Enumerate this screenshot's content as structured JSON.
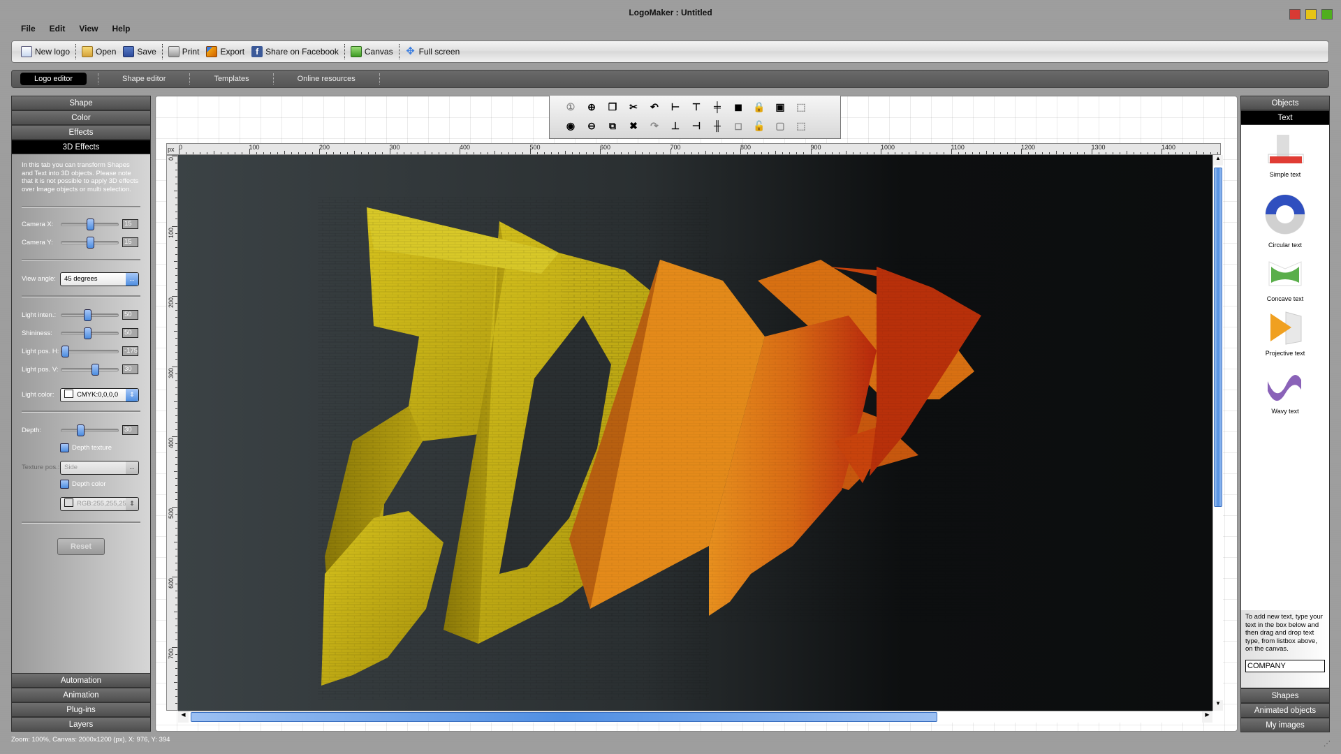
{
  "window": {
    "title": "LogoMaker : Untitled",
    "controls": {
      "close_color": "#d83a34",
      "minimize_color": "#e6c415",
      "maximize_color": "#4fae1e"
    }
  },
  "menubar": [
    "File",
    "Edit",
    "View",
    "Help"
  ],
  "toolbar": [
    {
      "label": "New logo",
      "icon": "new-logo-icon"
    },
    {
      "label": "Open",
      "icon": "folder-open-icon"
    },
    {
      "label": "Save",
      "icon": "floppy-disk-icon"
    },
    {
      "label": "Print",
      "icon": "printer-icon"
    },
    {
      "label": "Export",
      "icon": "export-icon"
    },
    {
      "label": "Share on Facebook",
      "icon": "facebook-icon"
    },
    {
      "label": "Canvas",
      "icon": "canvas-icon"
    },
    {
      "label": "Full screen",
      "icon": "fullscreen-arrows-icon"
    }
  ],
  "tabs": [
    {
      "label": "Logo editor",
      "active": true
    },
    {
      "label": "Shape editor",
      "active": false
    },
    {
      "label": "Templates",
      "active": false
    },
    {
      "label": "Online resources",
      "active": false
    }
  ],
  "left_panel": {
    "top_sections": [
      "Shape",
      "Color",
      "Effects",
      "3D Effects"
    ],
    "active_section": "3D Effects",
    "description": "In this tab you can transform Shapes and Text into 3D objects. Please note that it is not possible to apply 3D effects over Image objects or multi selection.",
    "camera_x": {
      "label": "Camera X:",
      "value": "15",
      "fraction": 0.5
    },
    "camera_y": {
      "label": "Camera Y:",
      "value": "15",
      "fraction": 0.5
    },
    "view_angle": {
      "label": "View angle:",
      "value": "45 degrees",
      "button": "..."
    },
    "light_intensity": {
      "label": "Light inten.:",
      "value": "50",
      "fraction": 0.45
    },
    "shininess": {
      "label": "Shininess:",
      "value": "50",
      "fraction": 0.45
    },
    "light_pos_h": {
      "label": "Light pos. H:",
      "value": "-175",
      "fraction": 0.0
    },
    "light_pos_v": {
      "label": "Light pos. V:",
      "value": "30",
      "fraction": 0.6
    },
    "light_color": {
      "label": "Light color:",
      "value": "CMYK:0,0,0,0"
    },
    "depth": {
      "label": "Depth:",
      "value": "30",
      "fraction": 0.3
    },
    "depth_texture": {
      "label": "Depth texture"
    },
    "texture_pos": {
      "label": "Texture pos.:",
      "value": "Side",
      "button": "..."
    },
    "depth_color": {
      "label": "Depth color",
      "value": "RGB:255,255,25"
    },
    "reset_label": "Reset",
    "bottom_sections": [
      "Automation",
      "Animation",
      "Plug-ins",
      "Layers"
    ]
  },
  "canvas_toolbar": {
    "row1": [
      {
        "icon": "zoom-actual-size-icon",
        "glyph": "①",
        "enabled": false
      },
      {
        "icon": "zoom-in-icon",
        "glyph": "⊕",
        "enabled": true
      },
      {
        "icon": "copy-icon",
        "glyph": "❐",
        "enabled": true
      },
      {
        "icon": "cut-icon",
        "glyph": "✂",
        "enabled": true
      },
      {
        "icon": "undo-icon",
        "glyph": "↶",
        "enabled": true
      },
      {
        "icon": "align-left-icon",
        "glyph": "⊢",
        "enabled": true
      },
      {
        "icon": "align-top-icon",
        "glyph": "⊤",
        "enabled": true
      },
      {
        "icon": "align-center-vertical-icon",
        "glyph": "╪",
        "enabled": true
      },
      {
        "icon": "bring-to-front-icon",
        "glyph": "◼",
        "enabled": true
      },
      {
        "icon": "lock-icon",
        "glyph": "🔒",
        "enabled": true
      },
      {
        "icon": "group-icon",
        "glyph": "▣",
        "enabled": true
      },
      {
        "icon": "select-all-icon",
        "glyph": "⬚",
        "enabled": false
      }
    ],
    "row2": [
      {
        "icon": "zoom-fit-icon",
        "glyph": "◉",
        "enabled": true
      },
      {
        "icon": "zoom-out-icon",
        "glyph": "⊖",
        "enabled": true
      },
      {
        "icon": "paste-icon",
        "glyph": "⧉",
        "enabled": true
      },
      {
        "icon": "delete-icon",
        "glyph": "✖",
        "enabled": true
      },
      {
        "icon": "redo-icon",
        "glyph": "↷",
        "enabled": false
      },
      {
        "icon": "align-bottom-icon",
        "glyph": "⊥",
        "enabled": true
      },
      {
        "icon": "align-right-icon",
        "glyph": "⊣",
        "enabled": true
      },
      {
        "icon": "align-center-horizontal-icon",
        "glyph": "╫",
        "enabled": true
      },
      {
        "icon": "send-to-back-icon",
        "glyph": "◻",
        "enabled": false
      },
      {
        "icon": "unlock-icon",
        "glyph": "🔓",
        "enabled": false
      },
      {
        "icon": "ungroup-icon",
        "glyph": "▢",
        "enabled": false
      },
      {
        "icon": "deselect-icon",
        "glyph": "⬚",
        "enabled": false
      }
    ]
  },
  "rulers": {
    "unit": "px",
    "horizontal_ticks": [
      "0",
      "100",
      "200",
      "300",
      "400",
      "500",
      "600",
      "700",
      "800",
      "900",
      "1000",
      "1100",
      "1200",
      "1300",
      "1400"
    ],
    "vertical_ticks": [
      "0",
      "100",
      "200",
      "300",
      "400",
      "500",
      "600",
      "700"
    ]
  },
  "canvas_content": {
    "word1": "3D",
    "word2": "TEXT",
    "word1_color": "#c9b218",
    "word2_colors": [
      "#e08a1a",
      "#c8360e"
    ]
  },
  "scrollbars": {
    "horizontal_fraction": 0.74,
    "vertical_fraction": 0.64
  },
  "right_panel": {
    "top_sections": [
      "Objects",
      "Text"
    ],
    "active_section": "Text",
    "objects": [
      {
        "label": "Simple text",
        "icon": "simple-text-icon"
      },
      {
        "label": "Circular text",
        "icon": "circular-text-icon"
      },
      {
        "label": "Concave text",
        "icon": "concave-text-icon"
      },
      {
        "label": "Projective text",
        "icon": "projective-text-icon"
      },
      {
        "label": "Wavy text",
        "icon": "wavy-text-icon"
      }
    ],
    "help_text": "To add new text, type your text in the box below and then drag and drop text type, from listbox above, on the canvas.",
    "text_input_value": "COMPANY",
    "bottom_sections": [
      "Shapes",
      "Animated objects",
      "My images"
    ]
  },
  "status": "Zoom: 100%, Canvas: 2000x1200 (px), X: 976, Y: 394"
}
